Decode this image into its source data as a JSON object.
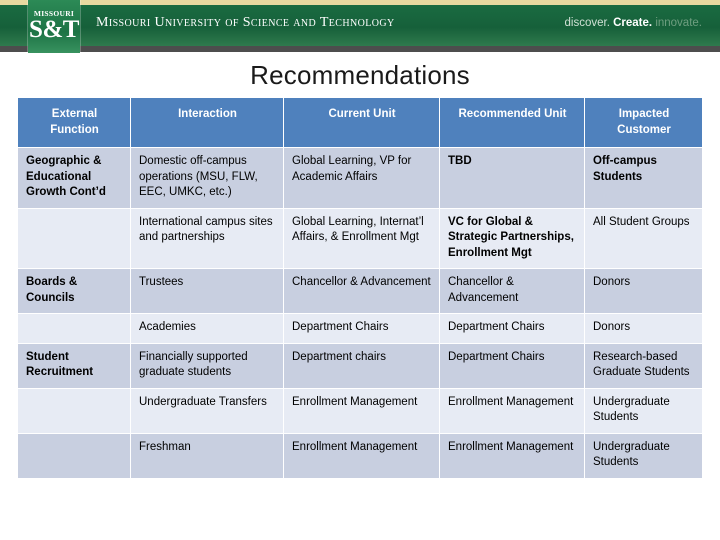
{
  "banner": {
    "logo_top": "MISSOURI",
    "logo_main": "S&T",
    "university_name": "Missouri University of Science and Technology",
    "tagline_1": "discover.",
    "tagline_2": "Create.",
    "tagline_3": "innovate.",
    "green": "#15603a",
    "gold": "#e8d9a0"
  },
  "slide": {
    "title": "Recommendations"
  },
  "table": {
    "header_color": "#4f81bd",
    "band_dark": "#c8cfe0",
    "band_light": "#e7ebf4",
    "highlight_color": "#c00000",
    "headers": [
      "External Function",
      "Interaction",
      "Current Unit",
      "Recommended Unit",
      "Impacted Customer"
    ],
    "rows": [
      {
        "band": "dark",
        "function": "Geographic & Educational Growth Cont’d",
        "interaction": "Domestic off-campus operations (MSU, FLW, EEC, UMKC, etc.)",
        "current_unit": "Global Learning, VP for Academic Affairs",
        "recommended_unit": "TBD",
        "recommended_highlight": true,
        "impacted_customer": "Off-campus Students",
        "customer_bold": true
      },
      {
        "band": "light",
        "function": "",
        "interaction": "International campus sites and partnerships",
        "current_unit": "Global Learning, Internat’l Affairs, & Enrollment Mgt",
        "recommended_unit": "VC for Global & Strategic Partnerships, Enrollment Mgt",
        "recommended_highlight": true,
        "impacted_customer": "All Student Groups",
        "customer_bold": false
      },
      {
        "band": "dark",
        "function": "Boards & Councils",
        "interaction": "Trustees",
        "current_unit": "Chancellor & Advancement",
        "recommended_unit": "Chancellor & Advancement",
        "recommended_highlight": false,
        "impacted_customer": "Donors",
        "customer_bold": false
      },
      {
        "band": "light",
        "function": "",
        "interaction": "Academies",
        "current_unit": "Department Chairs",
        "recommended_unit": "Department Chairs",
        "recommended_highlight": false,
        "impacted_customer": "Donors",
        "customer_bold": false
      },
      {
        "band": "dark",
        "function": "Student Recruitment",
        "interaction": "Financially supported graduate students",
        "current_unit": "Department chairs",
        "recommended_unit": "Department Chairs",
        "recommended_highlight": false,
        "impacted_customer": "Research-based Graduate Students",
        "customer_bold": false
      },
      {
        "band": "light",
        "function": "",
        "interaction": "Undergraduate Transfers",
        "current_unit": "Enrollment Management",
        "recommended_unit": "Enrollment Management",
        "recommended_highlight": false,
        "impacted_customer": "Undergraduate Students",
        "customer_bold": false
      },
      {
        "band": "dark",
        "function": "",
        "interaction": "Freshman",
        "current_unit": "Enrollment Management",
        "recommended_unit": "Enrollment Management",
        "recommended_highlight": false,
        "impacted_customer": "Undergraduate Students",
        "customer_bold": false
      }
    ]
  }
}
